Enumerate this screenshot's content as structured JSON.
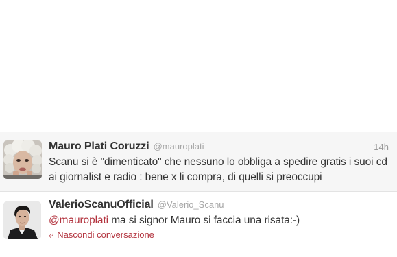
{
  "tweets": [
    {
      "fullname": "Mauro Plati Coruzzi",
      "username": "@mauroplati",
      "time": "14h",
      "text": "Scanu si è \"dimenticato\" che nessuno lo obbliga a spedire gratis i suoi cd ai giornalist e radio : bene x li compra, di quelli si preoccupi",
      "avatar_icon": "avatar-curly-white-hair"
    },
    {
      "fullname": "ValerioScanuOfficial",
      "username": "@Valerio_Scanu",
      "mention": "@mauroplati",
      "text": " ma si signor Mauro si faccia una risata:-)",
      "collapse_label": "Nascondi conversazione",
      "collapse_icon": "reply-arrow-icon",
      "avatar_icon": "avatar-dark-hair-man"
    }
  ],
  "colors": {
    "link": "#b3343f",
    "name": "#333333",
    "meta": "#a6a6a6",
    "highlight_bg": "#f6f6f6"
  }
}
